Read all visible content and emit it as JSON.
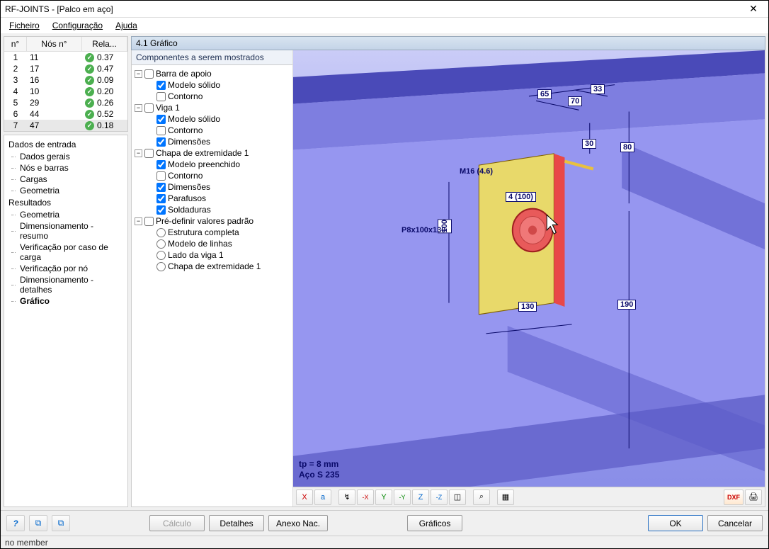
{
  "window": {
    "title": "RF-JOINTS - [Palco em aço]"
  },
  "menu": {
    "file": "Ficheiro",
    "config": "Configuração",
    "help": "Ajuda"
  },
  "table": {
    "headers": {
      "no": "n°",
      "nodes": "Nós n°",
      "ratio": "Rela..."
    },
    "rows": [
      {
        "no": "1",
        "nodes": "11",
        "ratio": "0.37"
      },
      {
        "no": "2",
        "nodes": "17",
        "ratio": "0.47"
      },
      {
        "no": "3",
        "nodes": "16",
        "ratio": "0.09"
      },
      {
        "no": "4",
        "nodes": "10",
        "ratio": "0.20"
      },
      {
        "no": "5",
        "nodes": "29",
        "ratio": "0.26"
      },
      {
        "no": "6",
        "nodes": "44",
        "ratio": "0.52"
      },
      {
        "no": "7",
        "nodes": "47",
        "ratio": "0.18"
      }
    ]
  },
  "nav": {
    "input_header": "Dados de entrada",
    "input": [
      "Dados gerais",
      "Nós e barras",
      "Cargas",
      "Geometria"
    ],
    "results_header": "Resultados",
    "results": [
      "Geometria",
      "Dimensionamento - resumo",
      "Verificação por caso de carga",
      "Verificação por nó",
      "Dimensionamento - detalhes",
      "Gráfico"
    ]
  },
  "panel": {
    "title": "4.1 Gráfico"
  },
  "tree": {
    "title": "Componentes a serem mostrados",
    "support": {
      "label": "Barra de apoio",
      "solid": "Modelo sólido",
      "contour": "Contorno"
    },
    "beam": {
      "label": "Viga 1",
      "solid": "Modelo sólido",
      "contour": "Contorno",
      "dims": "Dimensões"
    },
    "plate": {
      "label": "Chapa de extremidade 1",
      "filled": "Modelo preenchido",
      "contour": "Contorno",
      "dims": "Dimensões",
      "bolts": "Parafusos",
      "welds": "Soldaduras"
    },
    "preset": {
      "label": "Pré-definir valores padrão",
      "full": "Estrutura completa",
      "lines": "Modelo de linhas",
      "side": "Lado da viga 1",
      "endplate": "Chapa de extremidade 1"
    }
  },
  "viewport": {
    "dims": {
      "d65": "65",
      "d70": "70",
      "d33": "33",
      "d30": "30",
      "d80": "80",
      "d100": "100",
      "d130": "130",
      "d190": "190"
    },
    "labels": {
      "bolt_spec": "M16 (4.6)",
      "plate_spec": "P8x100x130",
      "bolt_count": "4 (100)"
    },
    "info": {
      "tp": "tp = 8 mm",
      "steel": "Aço S 235"
    }
  },
  "toolbar": {
    "axes_x": "X",
    "axes_a": "a",
    "view_iso": "↯",
    "view_x": "-X",
    "view_y": "Y",
    "view_ny": "-Y",
    "view_z": "Z",
    "view_nz": "-Z",
    "box": "◫",
    "zoom": "⌕",
    "layers": "▦",
    "dxf": "DXF",
    "print": "🖨"
  },
  "footer": {
    "help": "?",
    "b1": "⧉",
    "b2": "⧉",
    "calc": "Cálculo",
    "details": "Detalhes",
    "annex": "Anexo Nac.",
    "graphics": "Gráficos",
    "ok": "OK",
    "cancel": "Cancelar"
  },
  "status": {
    "text": "no member"
  }
}
